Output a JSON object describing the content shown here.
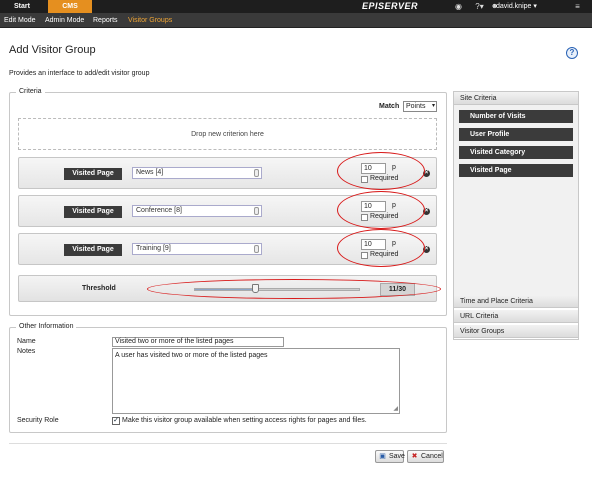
{
  "topbar": {
    "tabs": [
      {
        "label": "Start"
      },
      {
        "label": "CMS"
      }
    ],
    "brand": "EPISERVER",
    "user": "david.knipe"
  },
  "subnav": {
    "items": [
      {
        "label": "Edit Mode"
      },
      {
        "label": "Admin Mode"
      },
      {
        "label": "Reports"
      },
      {
        "label": "Visitor Groups"
      }
    ]
  },
  "page": {
    "title": "Add Visitor Group",
    "description": "Provides an interface to add/edit visitor group"
  },
  "criteria": {
    "legend": "Criteria",
    "match_label": "Match",
    "match_value": "Points",
    "drop_text": "Drop new criterion here",
    "rows": [
      {
        "tag": "Visited Page",
        "page": "News [4]",
        "points": "10",
        "unit": "p",
        "required_label": "Required"
      },
      {
        "tag": "Visited Page",
        "page": "Conference [8]",
        "points": "10",
        "unit": "p",
        "required_label": "Required"
      },
      {
        "tag": "Visited Page",
        "page": "Training [9]",
        "points": "10",
        "unit": "p",
        "required_label": "Required"
      }
    ],
    "threshold": {
      "label": "Threshold",
      "value": 11,
      "max": 30,
      "display": "11/30"
    }
  },
  "side_panel": {
    "site_criteria": "Site Criteria",
    "items": [
      {
        "label": "Number of Visits"
      },
      {
        "label": "User Profile"
      },
      {
        "label": "Visited Category"
      },
      {
        "label": "Visited Page"
      }
    ],
    "sections": [
      {
        "label": "Time and Place Criteria"
      },
      {
        "label": "URL Criteria"
      },
      {
        "label": "Visitor Groups"
      }
    ]
  },
  "other": {
    "legend": "Other Information",
    "name_label": "Name",
    "name_value": "Visited two or more of the listed pages",
    "notes_label": "Notes",
    "notes_value": "A user has visited two or more of the listed pages",
    "security_label": "Security Role",
    "security_checkbox_label": "Make this visitor group available when setting access rights for pages and files."
  },
  "actions": {
    "save": "Save",
    "cancel": "Cancel"
  },
  "colors": {
    "accent": "#e58f1f",
    "nav_active": "#f0a535",
    "annotation": "#d81b1b"
  }
}
